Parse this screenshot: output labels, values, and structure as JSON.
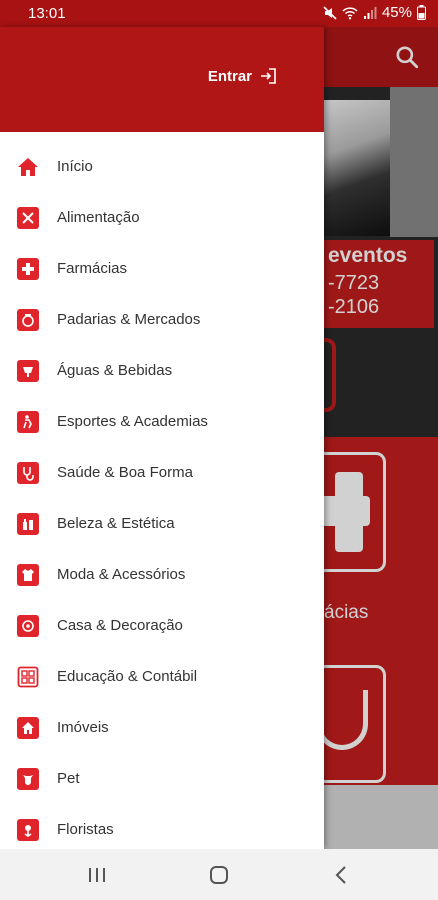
{
  "status_bar": {
    "time": "13:01",
    "battery": "45%"
  },
  "drawer": {
    "login_label": "Entrar",
    "items": [
      {
        "label": "Início",
        "icon": "home-icon"
      },
      {
        "label": "Alimentação",
        "icon": "restaurant-icon"
      },
      {
        "label": "Farmácias",
        "icon": "pharmacy-cross-icon"
      },
      {
        "label": "Padarias & Mercados",
        "icon": "bakery-icon"
      },
      {
        "label": "Águas & Bebidas",
        "icon": "beverage-icon"
      },
      {
        "label": "Esportes & Academias",
        "icon": "sports-icon"
      },
      {
        "label": "Saúde & Boa Forma",
        "icon": "stethoscope-icon"
      },
      {
        "label": "Beleza & Estética",
        "icon": "beauty-icon"
      },
      {
        "label": "Moda & Acessórios",
        "icon": "fashion-icon"
      },
      {
        "label": "Casa & Decoração",
        "icon": "home-decor-icon"
      },
      {
        "label": "Educação & Contábil",
        "icon": "education-icon"
      },
      {
        "label": "Imóveis",
        "icon": "real-estate-icon"
      },
      {
        "label": "Pet",
        "icon": "pet-icon"
      },
      {
        "label": "Floristas",
        "icon": "florist-icon"
      }
    ]
  },
  "background": {
    "banner_title": "eventos",
    "banner_phone_1": "-7723",
    "banner_phone_2": "-2106",
    "tile_label": "ácias"
  },
  "colors": {
    "primary": "#b01616",
    "accent": "#e0242b"
  }
}
